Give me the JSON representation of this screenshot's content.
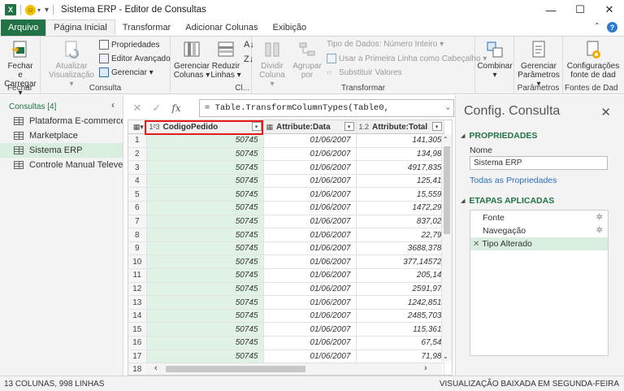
{
  "window": {
    "title": "Sistema ERP - Editor de Consultas",
    "app_icon_letter": "X",
    "smiley": "☺",
    "minimize": "—",
    "maximize": "☐",
    "close": "✕"
  },
  "tabs": [
    {
      "label": "Arquivo"
    },
    {
      "label": "Página Inicial"
    },
    {
      "label": "Transformar"
    },
    {
      "label": "Adicionar Colunas"
    },
    {
      "label": "Exibição"
    }
  ],
  "ribbon": {
    "fechar": {
      "btn1": "Fechar e",
      "btn2": "Carregar",
      "group": "Fechar"
    },
    "consulta": {
      "atualizar1": "Atualizar",
      "atualizar2": "Visualização",
      "propriedades": "Propriedades",
      "editor": "Editor Avançado",
      "gerenciar": "Gerenciar",
      "group": "Consulta"
    },
    "colunas": {
      "gerenciar1": "Gerenciar",
      "gerenciar2": "Colunas",
      "reduzir1": "Reduzir",
      "reduzir2": "Linhas",
      "group": "Cl..."
    },
    "transformar": {
      "dividir1": "Dividir",
      "dividir2": "Coluna",
      "agrupar1": "Agrupar",
      "agrupar2": "por",
      "tipo": "Tipo de Dados: Número Inteiro",
      "primeira_linha": "Usar a Primeira Linha como Cabeçalho",
      "substituir": "Substituir Valores",
      "group": "Transformar"
    },
    "combinar": {
      "label": "Combinar"
    },
    "parametros": {
      "btn1": "Gerenciar",
      "btn2": "Parâmetros",
      "group": "Parâmetros"
    },
    "fontes": {
      "btn1": "Configurações",
      "btn2": "fonte de dad",
      "group": "Fontes de Dad"
    }
  },
  "queries": {
    "header": "Consultas [4]",
    "items": [
      {
        "label": "Plataforma E-commerce"
      },
      {
        "label": "Marketplace"
      },
      {
        "label": "Sistema ERP"
      },
      {
        "label": "Controle Manual Televe..."
      }
    ]
  },
  "formula": {
    "cancel": "✕",
    "confirm": "✓",
    "fx": "fx",
    "text": "= Table.TransformColumnTypes(Table0,"
  },
  "grid": {
    "columns": [
      {
        "type": "1²3",
        "name": "CodigoPedido"
      },
      {
        "type": "",
        "name": "Attribute:Data"
      },
      {
        "type": "1.2",
        "name": "Attribute:Total"
      }
    ],
    "rows": [
      {
        "n": "1",
        "c1": "50745",
        "c2": "01/06/2007",
        "c3": "141,305"
      },
      {
        "n": "2",
        "c1": "50745",
        "c2": "01/06/2007",
        "c3": "134,98"
      },
      {
        "n": "3",
        "c1": "50745",
        "c2": "01/06/2007",
        "c3": "4917,835"
      },
      {
        "n": "4",
        "c1": "50745",
        "c2": "01/06/2007",
        "c3": "125,41"
      },
      {
        "n": "5",
        "c1": "50745",
        "c2": "01/06/2007",
        "c3": "15,559"
      },
      {
        "n": "6",
        "c1": "50745",
        "c2": "01/06/2007",
        "c3": "1472,29"
      },
      {
        "n": "7",
        "c1": "50745",
        "c2": "01/06/2007",
        "c3": "837,02"
      },
      {
        "n": "8",
        "c1": "50745",
        "c2": "01/06/2007",
        "c3": "22,79"
      },
      {
        "n": "9",
        "c1": "50745",
        "c2": "01/06/2007",
        "c3": "3688,378"
      },
      {
        "n": "10",
        "c1": "50745",
        "c2": "01/06/2007",
        "c3": "377,14572"
      },
      {
        "n": "11",
        "c1": "50745",
        "c2": "01/06/2007",
        "c3": "205,14"
      },
      {
        "n": "12",
        "c1": "50745",
        "c2": "01/06/2007",
        "c3": "2591,97"
      },
      {
        "n": "13",
        "c1": "50745",
        "c2": "01/06/2007",
        "c3": "1242,851"
      },
      {
        "n": "14",
        "c1": "50745",
        "c2": "01/06/2007",
        "c3": "2485,703"
      },
      {
        "n": "15",
        "c1": "50745",
        "c2": "01/06/2007",
        "c3": "115,361"
      },
      {
        "n": "16",
        "c1": "50745",
        "c2": "01/06/2007",
        "c3": "67,54"
      },
      {
        "n": "17",
        "c1": "50745",
        "c2": "01/06/2007",
        "c3": "71,98"
      },
      {
        "n": "18",
        "c1": "",
        "c2": "",
        "c3": ""
      }
    ]
  },
  "settings": {
    "title": "Config. Consulta",
    "properties_header": "PROPRIEDADES",
    "name_label": "Nome",
    "name_value": "Sistema ERP",
    "all_properties": "Todas as Propriedades",
    "steps_header": "ETAPAS APLICADAS",
    "steps": [
      {
        "label": "Fonte",
        "gear": "✲"
      },
      {
        "label": "Navegação",
        "gear": "✲"
      },
      {
        "label": "Tipo Alterado",
        "gear": ""
      }
    ]
  },
  "status": {
    "left": "13 COLUNAS, 998 LINHAS",
    "right": "VISUALIZAÇÃO BAIXADA EM SEGUNDA-FEIRA"
  },
  "colors": {
    "accent": "#217346",
    "selection": "#d9eedf",
    "highlight_border": "#e81b1b"
  }
}
